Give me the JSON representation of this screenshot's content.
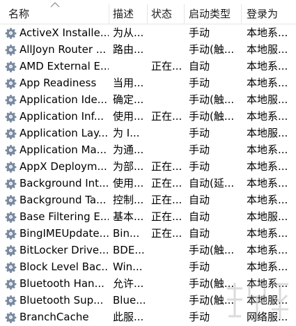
{
  "columns": {
    "name": "名称",
    "description": "描述",
    "status": "状态",
    "startup_type": "启动类型",
    "logon_as": "登录为"
  },
  "rows": [
    {
      "name": "ActiveX Installe...",
      "description": "为从...",
      "status": "",
      "startup_type": "手动",
      "logon_as": "本地系..."
    },
    {
      "name": "AllJoyn Router ...",
      "description": "路由...",
      "status": "",
      "startup_type": "手动(触...",
      "logon_as": "本地服..."
    },
    {
      "name": "AMD External E...",
      "description": "",
      "status": "正在...",
      "startup_type": "自动",
      "logon_as": "本地系..."
    },
    {
      "name": "App Readiness",
      "description": "当用...",
      "status": "",
      "startup_type": "手动",
      "logon_as": "本地系..."
    },
    {
      "name": "Application Ide...",
      "description": "确定...",
      "status": "",
      "startup_type": "手动(触...",
      "logon_as": "本地服..."
    },
    {
      "name": "Application Inf...",
      "description": "使用...",
      "status": "正在...",
      "startup_type": "手动(触...",
      "logon_as": "本地系..."
    },
    {
      "name": "Application Lay...",
      "description": "为 I...",
      "status": "",
      "startup_type": "手动",
      "logon_as": "本地服..."
    },
    {
      "name": "Application Ma...",
      "description": "为通...",
      "status": "",
      "startup_type": "手动",
      "logon_as": "本地系..."
    },
    {
      "name": "AppX Deploym...",
      "description": "为部...",
      "status": "正在...",
      "startup_type": "手动",
      "logon_as": "本地系..."
    },
    {
      "name": "Background Int...",
      "description": "使用...",
      "status": "正在...",
      "startup_type": "自动(延...",
      "logon_as": "本地系..."
    },
    {
      "name": "Background Ta...",
      "description": "控制...",
      "status": "正在...",
      "startup_type": "自动",
      "logon_as": "本地系..."
    },
    {
      "name": "Base Filtering E...",
      "description": "基本...",
      "status": "正在...",
      "startup_type": "自动",
      "logon_as": "本地服..."
    },
    {
      "name": "BingIMEUpdate...",
      "description": "Bin...",
      "status": "正在...",
      "startup_type": "自动",
      "logon_as": "本地系..."
    },
    {
      "name": "BitLocker Drive...",
      "description": "BDE...",
      "status": "",
      "startup_type": "手动(触...",
      "logon_as": "本地系..."
    },
    {
      "name": "Block Level Bac...",
      "description": "Win...",
      "status": "",
      "startup_type": "手动",
      "logon_as": "本地系..."
    },
    {
      "name": "Bluetooth Han...",
      "description": "允许...",
      "status": "",
      "startup_type": "手动(触...",
      "logon_as": "本地系..."
    },
    {
      "name": "Bluetooth Sup...",
      "description": "Blue...",
      "status": "",
      "startup_type": "手动(触...",
      "logon_as": "本地服..."
    },
    {
      "name": "BranchCache",
      "description": "此服...",
      "status": "",
      "startup_type": "手动",
      "logon_as": "网络服..."
    }
  ],
  "icons": {
    "service": "gear-icon",
    "sort": "sort-ascending-icon"
  },
  "colors": {
    "background": "#ffffff",
    "text": "#000000",
    "header_border": "#e5e5e5",
    "sort_arrow": "#8a8a8a",
    "gear": "#7a8aa0"
  }
}
